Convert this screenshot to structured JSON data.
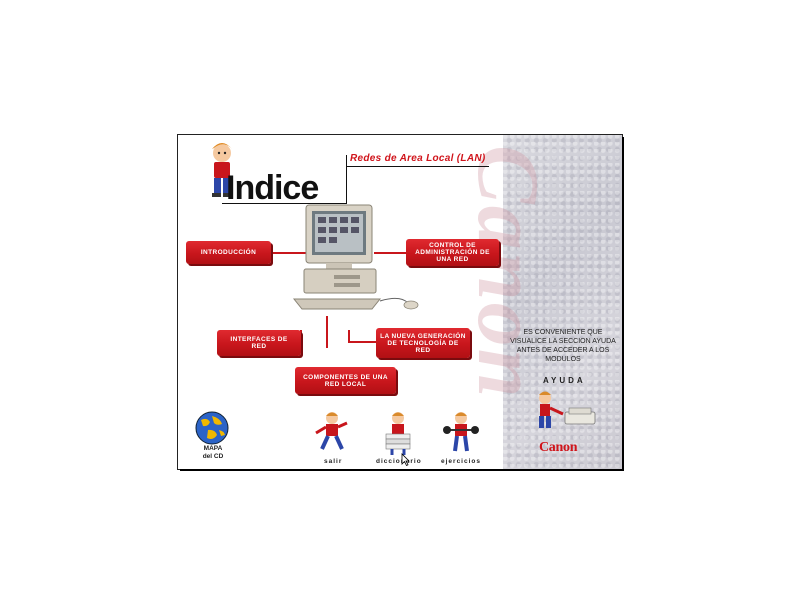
{
  "header": {
    "title": "Indice",
    "subtitle": "Redes de Area Local (LAN)"
  },
  "menu": {
    "introduccion": "INTRODUCCIÓN",
    "control": "CONTROL DE ADMINISTRACIÓN DE UNA RED",
    "interfaces": "INTERFACES DE RED",
    "nueva_generacion": "LA NUEVA GENERACIÓN DE TECNOLOGÍA DE RED",
    "componentes": "COMPONENTES DE UNA RED LOCAL"
  },
  "bottom_nav": {
    "mapa_line1": "MAPA",
    "mapa_line2": "del CD",
    "salir": "salir",
    "diccionario": "diccionario",
    "ejercicios": "ejercicios"
  },
  "side_panel": {
    "note": "ES CONVENIENTE QUE VISUALICE LA SECCION AYUDA ANTES DE ACCEDER A LOS MODULOS",
    "ayuda_label": "AYUDA",
    "brand": "Canon",
    "watermark": "Canon"
  },
  "colors": {
    "accent_red": "#c8161c",
    "panel_grey": "#d2d1d8"
  }
}
